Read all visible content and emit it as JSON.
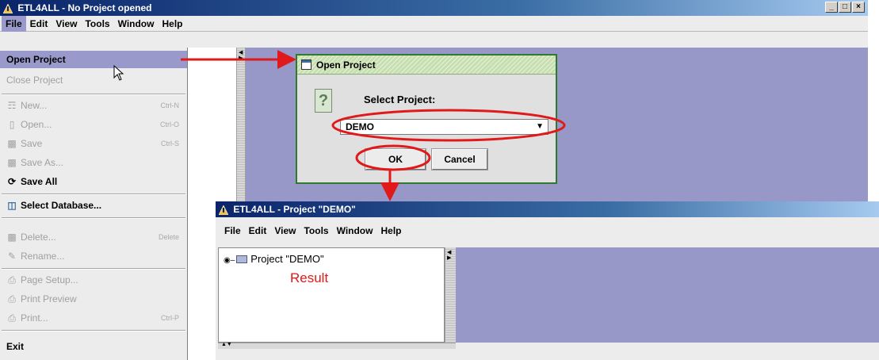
{
  "main_window": {
    "title": "ETL4ALL - No Project opened",
    "controls": [
      "_",
      "□",
      "×"
    ]
  },
  "menubar": {
    "items": [
      "File",
      "Edit",
      "View",
      "Tools",
      "Window",
      "Help"
    ]
  },
  "file_menu": {
    "open_project": "Open Project",
    "close_project": "Close Project",
    "new": "New...",
    "new_shortcut": "Ctrl-N",
    "open": "Open...",
    "open_shortcut": "Ctrl-O",
    "save": "Save",
    "save_shortcut": "Ctrl-S",
    "save_as": "Save As...",
    "save_all": "Save All",
    "select_database": "Select Database...",
    "delete": "Delete...",
    "delete_shortcut": "Delete",
    "rename": "Rename...",
    "page_setup": "Page Setup...",
    "print_preview": "Print Preview",
    "print": "Print...",
    "print_shortcut": "Ctrl-P",
    "exit": "Exit"
  },
  "dialog": {
    "title": "Open Project",
    "label": "Select Project:",
    "selected_value": "DEMO",
    "ok_label": "OK",
    "cancel_label": "Cancel"
  },
  "result_window": {
    "title": "ETL4ALL - Project \"DEMO\"",
    "menu": [
      "File",
      "Edit",
      "View",
      "Tools",
      "Window",
      "Help"
    ],
    "tree_item": "Project \"DEMO\"",
    "annotation": "Result"
  },
  "colors": {
    "highlight": "#9999cc",
    "desktop": "#9898c8",
    "annotation_red": "#e01a1a",
    "dialog_border": "#2f7a2f"
  }
}
